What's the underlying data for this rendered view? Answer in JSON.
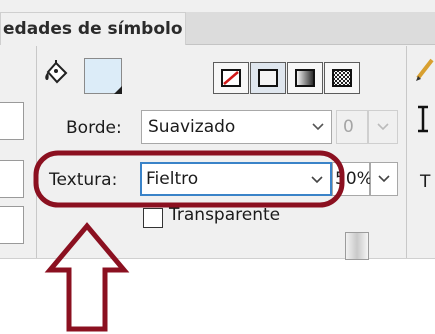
{
  "title_tab": "edades de símbolo",
  "borde": {
    "label": "Borde:",
    "value": "Suavizado",
    "size_value": "0"
  },
  "textura": {
    "label": "Textura:",
    "value": "Fieltro",
    "percent": "50%"
  },
  "transparente_label": "Transparente",
  "right_edge_label": "T",
  "highlight_color": "#8b1020",
  "arrow_color": "#8b1020",
  "icons": [
    "paint-bucket-icon",
    "no-fill-icon",
    "solid-fill-icon",
    "gradient-fill-icon",
    "pattern-fill-icon",
    "pencil-icon",
    "text-cursor-icon"
  ]
}
